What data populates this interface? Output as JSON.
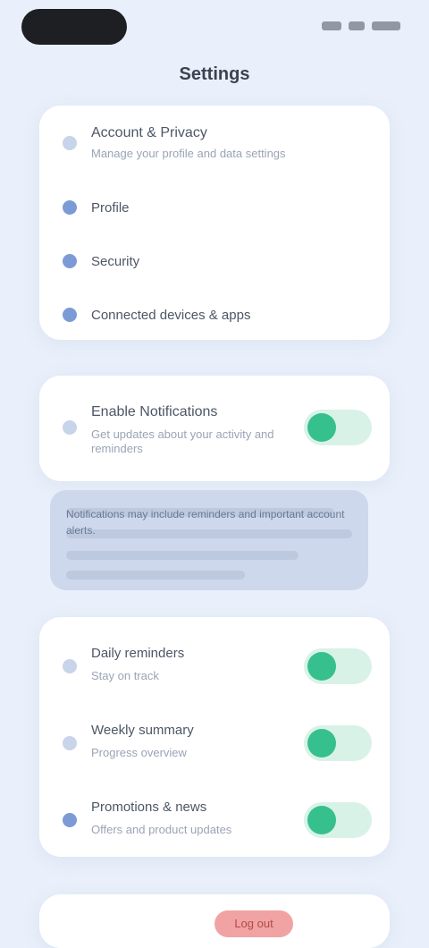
{
  "status": {
    "time": ""
  },
  "header": {
    "title": "Settings"
  },
  "section1": {
    "heading": "Account & Privacy",
    "subheading": "Manage your profile and data settings",
    "items": [
      {
        "label": "Profile"
      },
      {
        "label": "Security"
      },
      {
        "label": "Connected devices & apps"
      }
    ]
  },
  "section2": {
    "title": "Enable Notifications",
    "subtitle": "Get updates about your activity and reminders",
    "toggle_on": true
  },
  "info": {
    "text": "Notifications may include reminders and important account alerts."
  },
  "section3": {
    "items": [
      {
        "title": "Daily reminders",
        "subtitle": "Stay on track",
        "toggle_on": true
      },
      {
        "title": "Weekly summary",
        "subtitle": "Progress overview",
        "toggle_on": true
      },
      {
        "title": "Promotions & news",
        "subtitle": "Offers and product updates",
        "toggle_on": true
      }
    ]
  },
  "footer": {
    "danger_label": "Log out"
  },
  "colors": {
    "background": "#e9f0fb",
    "card": "#ffffff",
    "accent_green": "#36c08d",
    "toggle_track": "#d9f2e8",
    "accent_blue": "#7c9bd6",
    "danger": "#f1a3a3"
  }
}
